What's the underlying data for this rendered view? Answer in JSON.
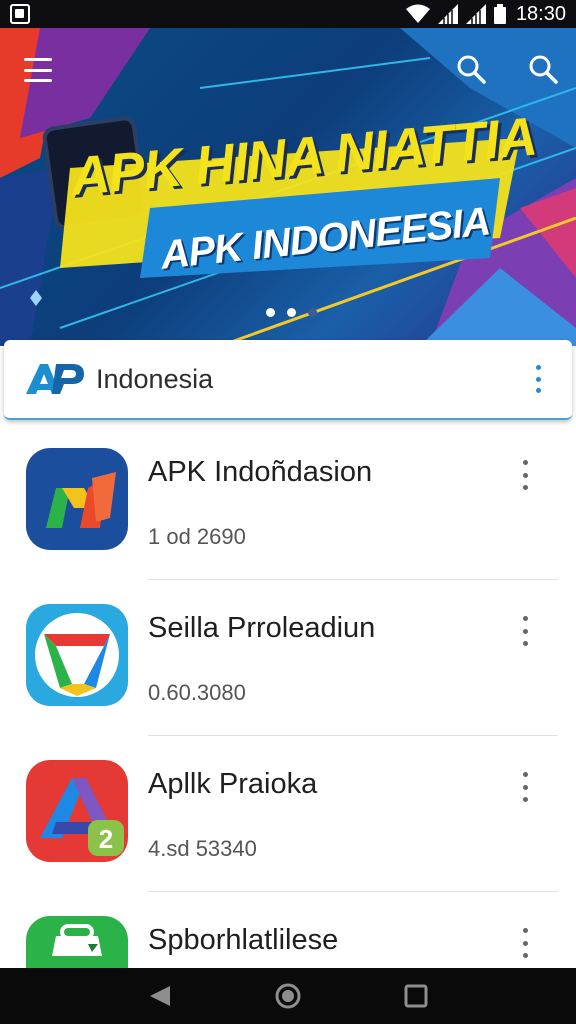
{
  "status_bar": {
    "time": "18:30",
    "icons": [
      "notification-icon",
      "wifi-icon",
      "signal-icon",
      "signal-icon",
      "battery-icon"
    ]
  },
  "banner": {
    "title": "APK HINA NIATTIA",
    "subtitle": "APK INDONEESIA",
    "page_dots": 3,
    "active_dot": 1,
    "colors": {
      "title": "#f4e21c",
      "background": "#0d3d7a"
    }
  },
  "header": {
    "logo_text": "AP",
    "title": "Indonesia",
    "accent": "#1d8fd0"
  },
  "apps": [
    {
      "name": "APK Indoñdasion",
      "meta": "1 od 2690",
      "icon": "apk-indonesia-icon"
    },
    {
      "name": "Seilla Prroleadiun",
      "meta": "0.60.3080",
      "icon": "seilla-app-icon"
    },
    {
      "name": "Apllk  Praioka",
      "meta": "4.sd 53340",
      "icon": "apllk-app-icon"
    },
    {
      "name": "Spborhlatlilese",
      "meta": "",
      "icon": "shopping-bag-icon"
    }
  ],
  "nav": {
    "buttons": [
      "back-icon",
      "home-icon",
      "recents-icon"
    ]
  }
}
